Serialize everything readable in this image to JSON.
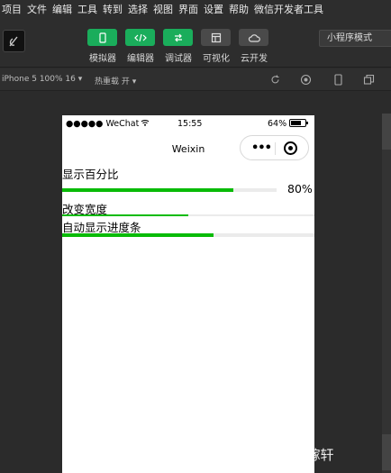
{
  "menu": [
    "项目",
    "文件",
    "编辑",
    "工具",
    "转到",
    "选择",
    "视图",
    "界面",
    "设置",
    "帮助",
    "微信开发者工具"
  ],
  "toolbar": {
    "buttons": [
      {
        "label": "模拟器",
        "icon": "phone-icon"
      },
      {
        "label": "编辑器",
        "icon": "code-icon"
      },
      {
        "label": "调试器",
        "icon": "debug-icon"
      },
      {
        "label": "可视化",
        "icon": "layout-icon"
      },
      {
        "label": "云开发",
        "icon": "cloud-icon"
      }
    ],
    "mode": "小程序模式"
  },
  "subbar": {
    "device": "iPhone 5 100% 16 ▾",
    "hot_reload": "热重载 开 ▾"
  },
  "phone": {
    "status": {
      "carrier": "●●●●● WeChat",
      "time": "15:55",
      "battery": "64%"
    },
    "nav_title": "Weixin",
    "progress_items": [
      {
        "label": "显示百分比",
        "percent_text": "80%",
        "percent": 80
      },
      {
        "label": "改变宽度",
        "percent": 50
      },
      {
        "label": "自动显示进度条",
        "percent": 60
      }
    ]
  },
  "watermark": "CSDN @叶仪景——星稼轩",
  "colors": {
    "accent": "#1aad5b",
    "progress": "#09bb07"
  }
}
